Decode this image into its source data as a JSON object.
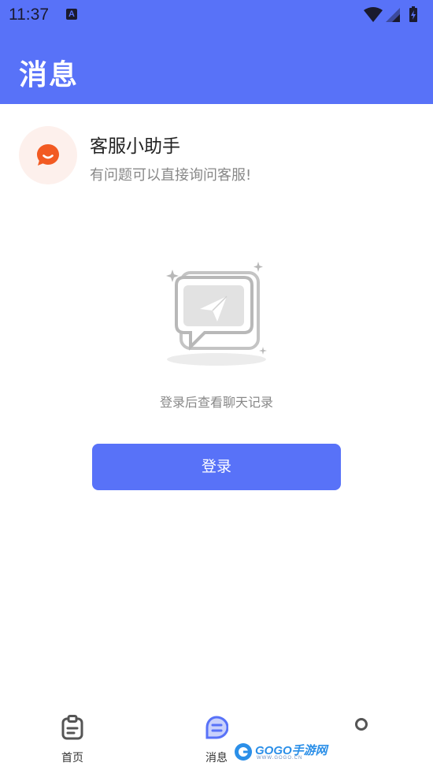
{
  "status_bar": {
    "time": "11:37",
    "notification_badge": "A"
  },
  "header": {
    "title": "消息"
  },
  "assistant": {
    "name": "客服小助手",
    "description": "有问题可以直接询问客服!"
  },
  "empty_state": {
    "hint": "登录后查看聊天记录"
  },
  "login_button": {
    "label": "登录"
  },
  "tabbar": {
    "items": [
      {
        "label": "首页",
        "icon": "clipboard-icon"
      },
      {
        "label": "消息",
        "icon": "message-icon"
      },
      {
        "label": "",
        "icon": "profile-icon"
      }
    ]
  },
  "watermark": {
    "text": "GOGO手游网",
    "url": "WWW.GOGO.CN"
  },
  "colors": {
    "brand": "#5872f8",
    "assistant_accent": "#f25a22"
  }
}
